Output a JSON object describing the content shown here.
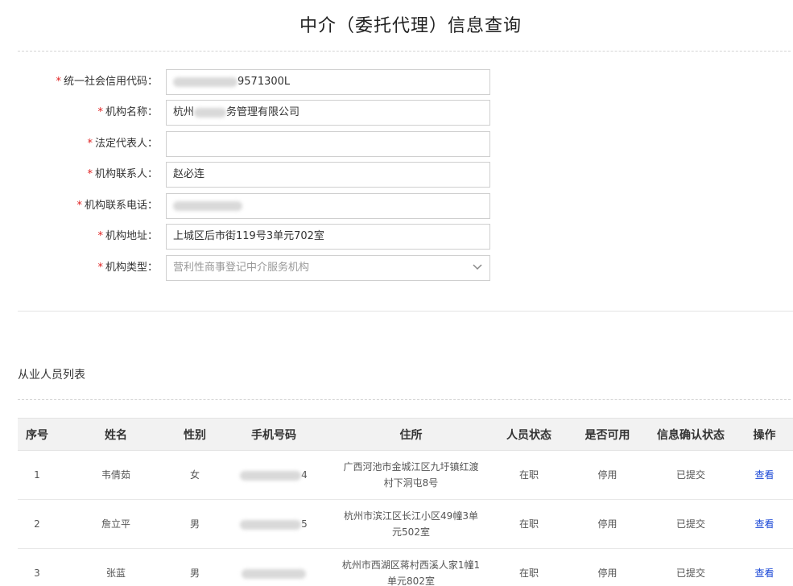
{
  "page": {
    "title": "中介（委托代理）信息查询"
  },
  "form": {
    "fields": [
      {
        "label": "统一社会信用代码：",
        "value": "9571300L"
      },
      {
        "label": "机构名称：",
        "value": "杭州",
        "value2": "务管理有限公司"
      },
      {
        "label": "法定代表人：",
        "value": ""
      },
      {
        "label": "机构联系人：",
        "value": "赵必连"
      },
      {
        "label": "机构联系电话：",
        "value": ""
      },
      {
        "label": "机构地址：",
        "value": "上城区后市街119号3单元702室"
      },
      {
        "label": "机构类型：",
        "value": "营利性商事登记中介服务机构"
      }
    ]
  },
  "staff": {
    "section_title": "从业人员列表",
    "columns": [
      "序号",
      "姓名",
      "性别",
      "手机号码",
      "住所",
      "人员状态",
      "是否可用",
      "信息确认状态",
      "操作"
    ],
    "rows": [
      {
        "index": "1",
        "name": "韦倩茹",
        "gender": "女",
        "phone_tail": "4",
        "address": "广西河池市金城江区九圩镇红渡村下洞屯8号",
        "status": "在职",
        "available": "停用",
        "confirm": "已提交",
        "action": "查看"
      },
      {
        "index": "2",
        "name": "詹立平",
        "gender": "男",
        "phone_tail": "5",
        "address": "杭州市滨江区长江小区49幢3单元502室",
        "status": "在职",
        "available": "停用",
        "confirm": "已提交",
        "action": "查看"
      },
      {
        "index": "3",
        "name": "张蓝",
        "gender": "男",
        "phone_tail": "",
        "address": "杭州市西湖区蒋村西溪人家1幢1单元802室",
        "status": "在职",
        "available": "停用",
        "confirm": "已提交",
        "action": "查看"
      }
    ]
  },
  "colors": {
    "required": "#e02020",
    "link": "#1a47d6",
    "header_bg": "#f2f2f2"
  }
}
